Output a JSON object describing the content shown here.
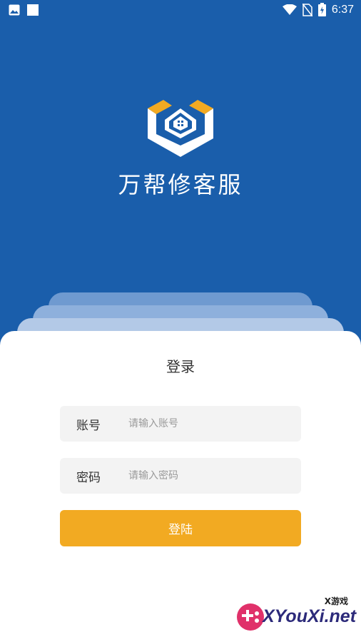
{
  "status_bar": {
    "time": "6:37",
    "icons": [
      "gallery-icon",
      "square-icon",
      "wifi-icon",
      "no-sim-icon",
      "battery-charging-icon"
    ]
  },
  "brand": {
    "app_name": "万帮修客服",
    "logo_icon": "house-shield-logo",
    "colors": {
      "background": "#1a5eab",
      "logo_white": "#ffffff",
      "logo_accent": "#f2aa22"
    }
  },
  "login": {
    "title": "登录",
    "account_label": "账号",
    "account_placeholder": "请输入账号",
    "account_value": "",
    "password_label": "密码",
    "password_placeholder": "请输入密码",
    "password_value": "",
    "submit_label": "登陆",
    "colors": {
      "button": "#f2aa22",
      "field_bg": "#f3f3f3"
    }
  },
  "watermark": {
    "top_text": "X游戏",
    "text": "XYouXi.net"
  }
}
